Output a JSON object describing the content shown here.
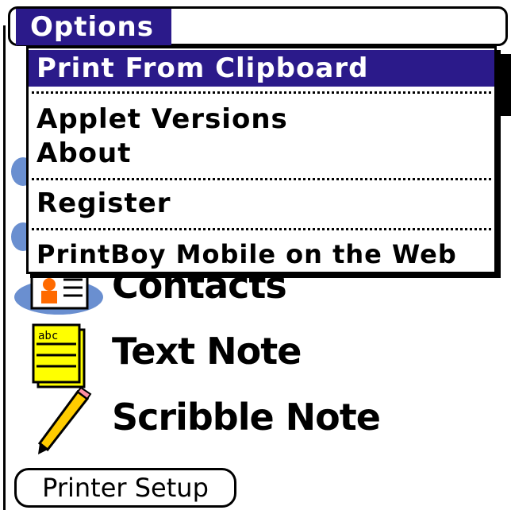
{
  "menubar": {
    "title": "Options"
  },
  "dropdown": {
    "items": [
      {
        "label": "Print From Clipboard",
        "selected": true
      },
      {
        "label": "Applet Versions"
      },
      {
        "label": "About"
      },
      {
        "label": "Register"
      },
      {
        "label": "PrintBoy Mobile on the Web"
      }
    ]
  },
  "launcher": {
    "items": [
      {
        "label": "Contacts",
        "icon": "contacts-icon"
      },
      {
        "label": "Text Note",
        "icon": "text-note-icon"
      },
      {
        "label": "Scribble Note",
        "icon": "pencil-icon"
      }
    ],
    "text_note_icon_text": "abc"
  },
  "printer_setup": {
    "label": "Printer Setup"
  },
  "colors": {
    "highlight": "#2b1a8a",
    "note_yellow": "#ffff00",
    "contacts_blue": "#6a8fd0"
  }
}
